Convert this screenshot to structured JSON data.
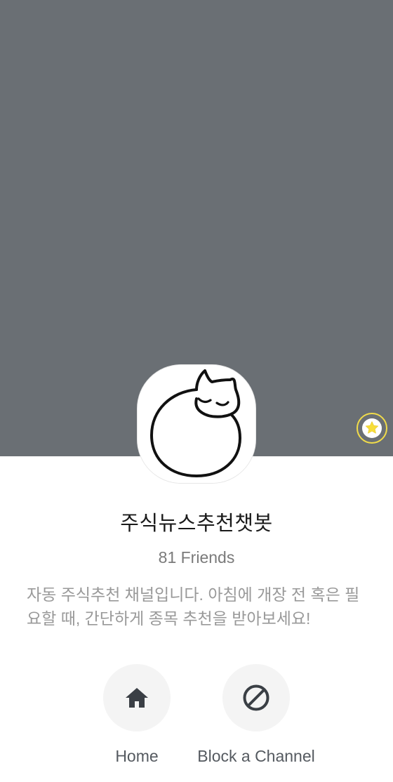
{
  "channel": {
    "name": "주식뉴스추천챗봇",
    "friends": "81 Friends",
    "description": "자동 주식추천 채널입니다. 아침에 개장 전 혹은 필요할 때, 간단하게 종목 추천을 받아보세요!"
  },
  "actions": [
    {
      "label": "Home",
      "icon": "home-icon"
    },
    {
      "label": "Block a Channel",
      "icon": "block-icon"
    }
  ],
  "colors": {
    "cover": "#6a6f74",
    "favorite_ring": "#f1dc4a",
    "favorite_star": "#f7de3a"
  }
}
